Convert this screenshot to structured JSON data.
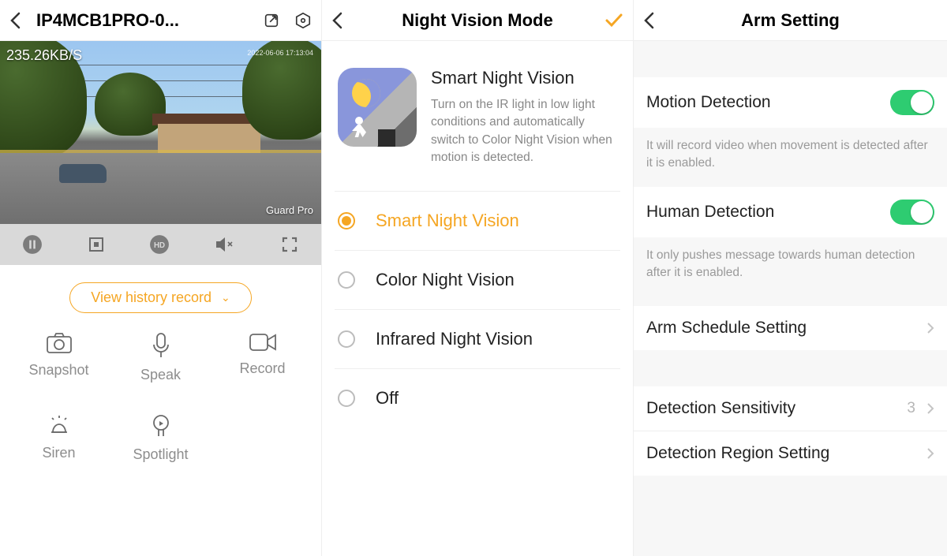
{
  "panel1": {
    "title": "IP4MCB1PRO-0...",
    "kbps": "235.26KB/S",
    "timestamp": "2022-06-06 17:13:04",
    "watermark": "Guard Pro",
    "history_label": "View history record",
    "actions": {
      "snapshot": "Snapshot",
      "speak": "Speak",
      "record": "Record",
      "siren": "Siren",
      "spotlight": "Spotlight"
    }
  },
  "panel2": {
    "title": "Night Vision Mode",
    "hero_title": "Smart Night Vision",
    "hero_desc": "Turn on the IR light in low light conditions and automatically switch to Color Night Vision when motion is detected.",
    "options": {
      "smart": "Smart Night Vision",
      "color": "Color Night Vision",
      "ir": "Infrared Night Vision",
      "off": "Off"
    },
    "selected": "smart"
  },
  "panel3": {
    "title": "Arm Setting",
    "motion": {
      "label": "Motion Detection",
      "enabled": true,
      "desc": "It will record video when movement is detected after it is enabled."
    },
    "human": {
      "label": "Human Detection",
      "enabled": true,
      "desc": "It only pushes message towards human detection after it is enabled."
    },
    "schedule": "Arm Schedule Setting",
    "sensitivity_label": "Detection Sensitivity",
    "sensitivity_value": "3",
    "region": "Detection Region Setting"
  }
}
